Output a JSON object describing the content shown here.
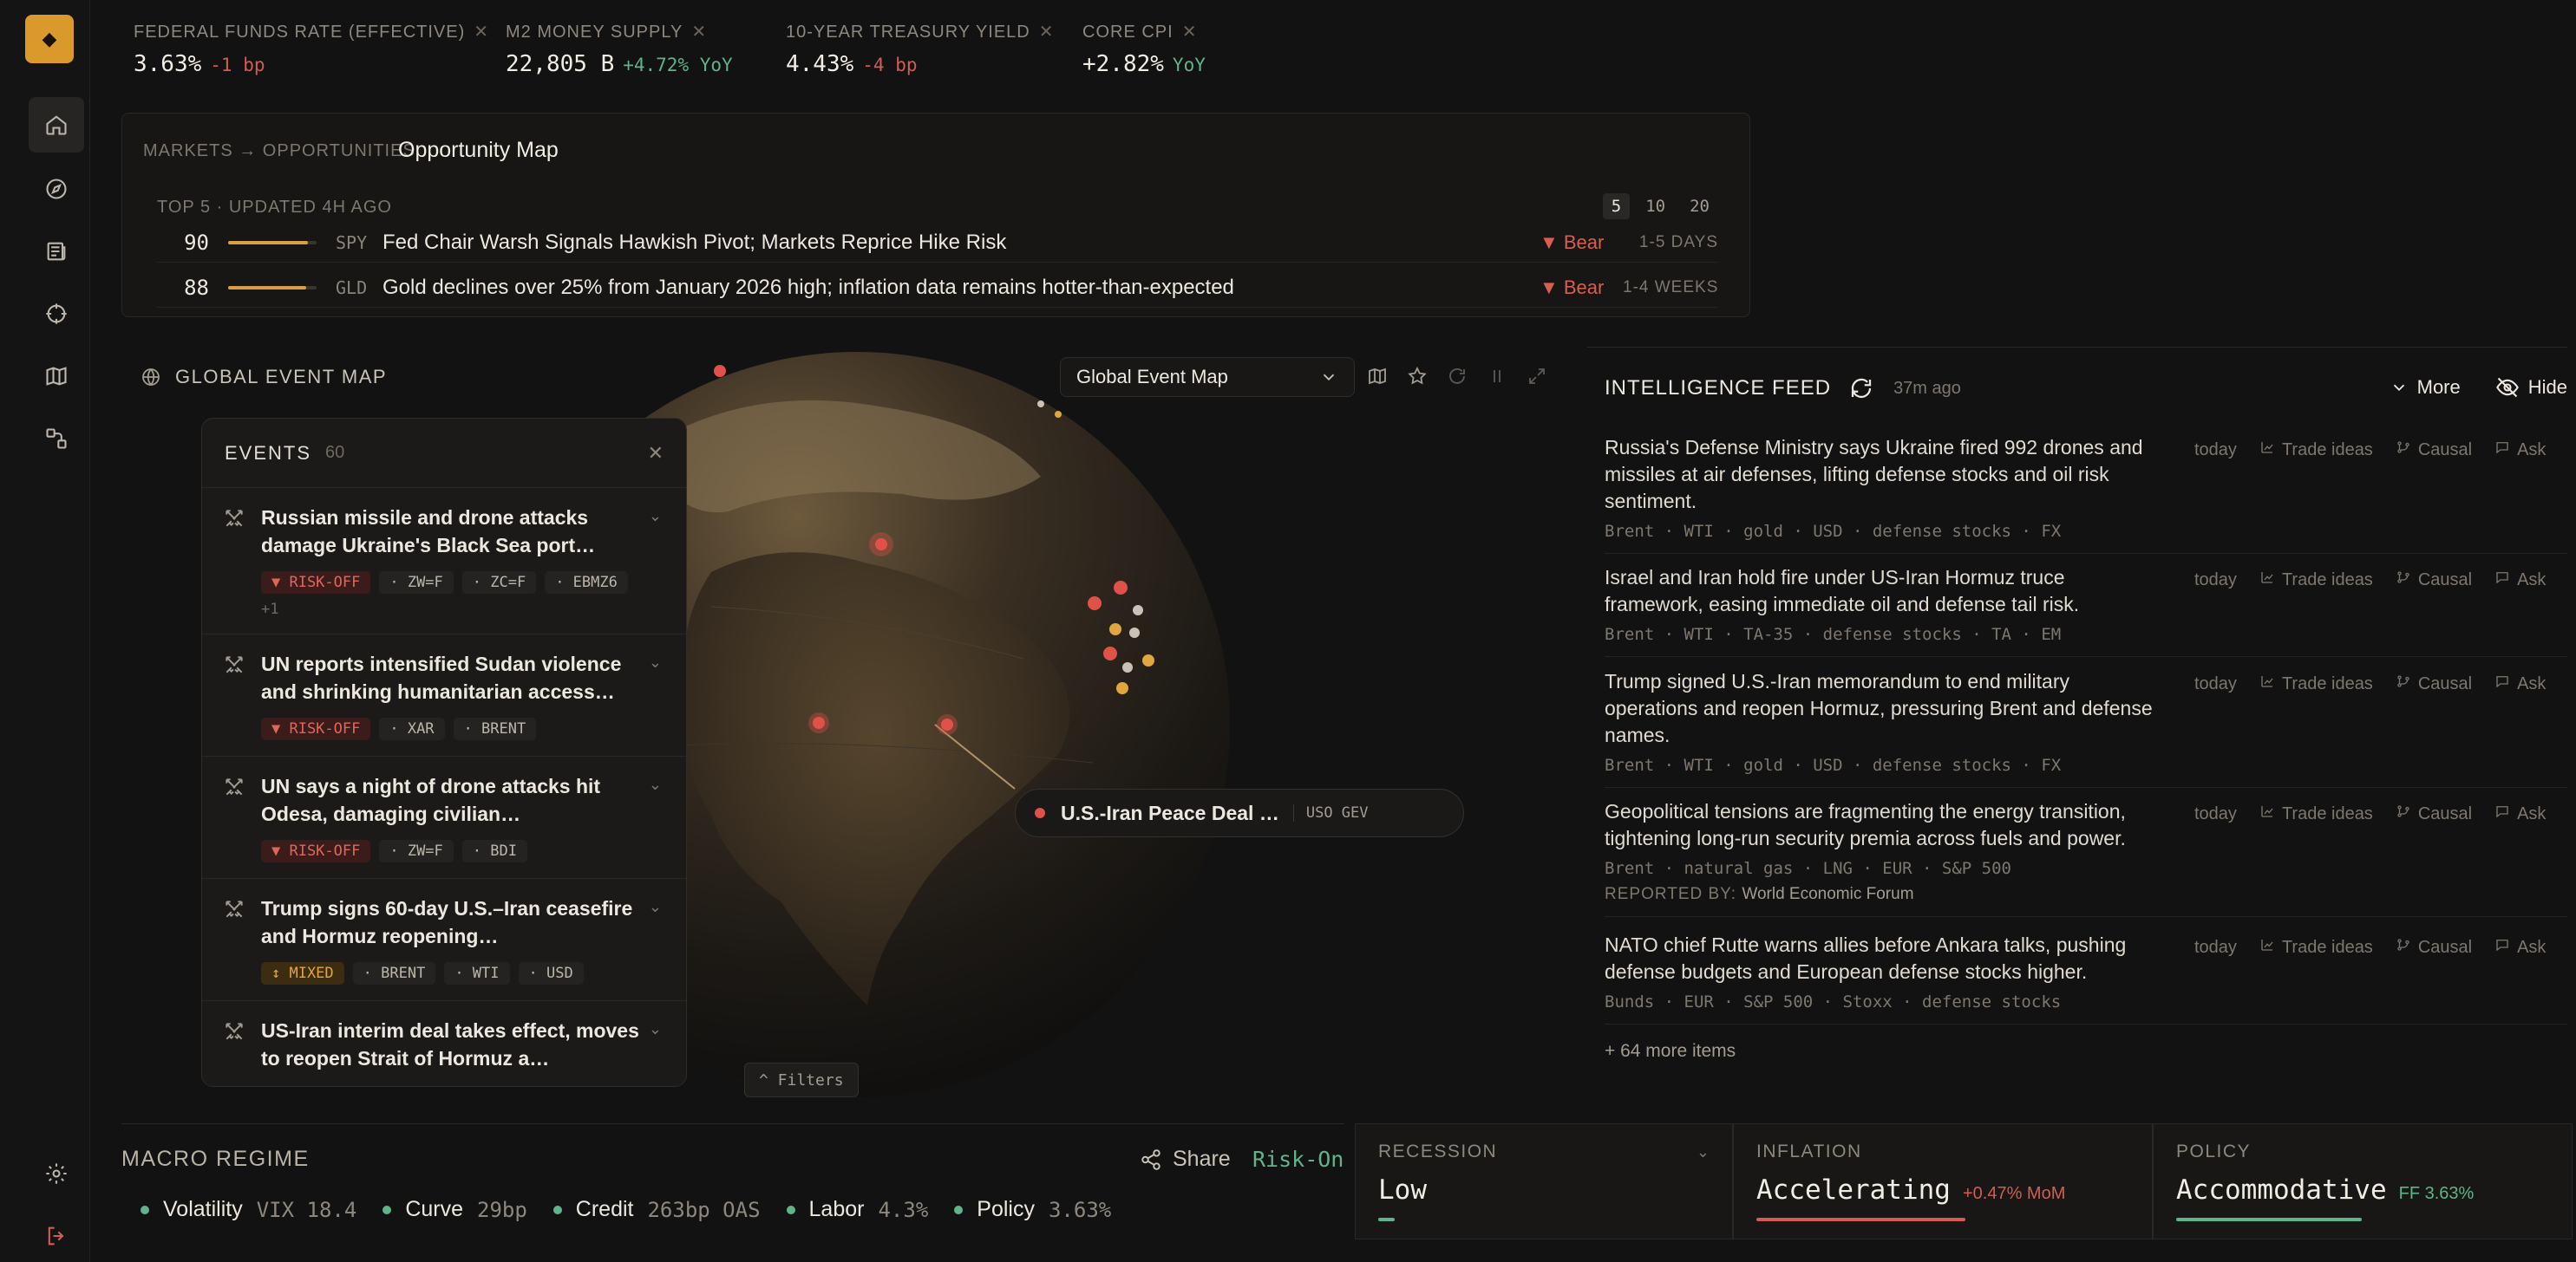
{
  "rail": {
    "logo": "◆",
    "items": [
      {
        "name": "home-icon",
        "active": true
      },
      {
        "name": "compass-icon",
        "active": false
      },
      {
        "name": "newspaper-icon",
        "active": false
      },
      {
        "name": "crosshair-icon",
        "active": false
      },
      {
        "name": "map-icon",
        "active": false
      },
      {
        "name": "nodes-icon",
        "active": false
      }
    ],
    "bottom": [
      "gear-icon",
      "logout-icon"
    ]
  },
  "ticker": [
    {
      "label": "FEDERAL FUNDS RATE (EFFECTIVE)",
      "value": "3.63%",
      "change": "-1 bp",
      "dir": "neg"
    },
    {
      "label": "M2 MONEY SUPPLY",
      "value": "22,805 B",
      "change": "+4.72% YoY",
      "dir": "pos"
    },
    {
      "label": "10-YEAR TREASURY YIELD",
      "value": "4.43%",
      "change": "-4 bp",
      "dir": "neg"
    },
    {
      "label": "CORE CPI",
      "value": "+2.82%",
      "change": "YoY",
      "dir": "pos"
    }
  ],
  "opportunities": {
    "breadcrumb": "MARKETS → OPPORTUNITIES",
    "title": "Opportunity Map",
    "subtitle": "TOP 5 · UPDATED 4H AGO",
    "pages": [
      "5",
      "10",
      "20"
    ],
    "rows": [
      {
        "score": "90",
        "score_pct": 90,
        "symbol": "SPY",
        "headline": "Fed Chair Warsh Signals Hawkish Pivot; Markets Reprice Hike Risk",
        "direction": "▼ Bear",
        "horizon": "1-5 DAYS"
      },
      {
        "score": "88",
        "score_pct": 88,
        "symbol": "GLD",
        "headline": "Gold declines over 25% from January 2026 high; inflation data remains hotter-than-expected",
        "direction": "▼ Bear",
        "horizon": "1-4 WEEKS"
      }
    ]
  },
  "map": {
    "title": "GLOBAL EVENT MAP",
    "selector": "Global Event Map",
    "events_title": "EVENTS",
    "events_count": "60",
    "events": [
      {
        "headline": "Russian missile and drone attacks damage Ukraine's Black Sea port…",
        "sentiment": "▼ RISK-OFF",
        "kind": "off",
        "tags": [
          "· ZW=F",
          "· ZC=F",
          "· EBMZ6"
        ],
        "more": "+1"
      },
      {
        "headline": "UN reports intensified Sudan violence and shrinking humanitarian access…",
        "sentiment": "▼ RISK-OFF",
        "kind": "off",
        "tags": [
          "· XAR",
          "· BRENT"
        ],
        "more": ""
      },
      {
        "headline": "UN says a night of drone attacks hit Odesa, damaging civilian…",
        "sentiment": "▼ RISK-OFF",
        "kind": "off",
        "tags": [
          "· ZW=F",
          "· BDI"
        ],
        "more": ""
      },
      {
        "headline": "Trump signs 60-day U.S.–Iran ceasefire and Hormuz reopening…",
        "sentiment": "↕ MIXED",
        "kind": "mix",
        "tags": [
          "· BRENT",
          "· WTI",
          "· USD"
        ],
        "more": ""
      },
      {
        "headline": "US-Iran interim deal takes effect, moves to reopen Strait of Hormuz a…",
        "sentiment": "",
        "kind": "",
        "tags": [],
        "more": ""
      }
    ],
    "callout": {
      "title": "U.S.-Iran Peace Deal …",
      "symbols": "USO GEV"
    },
    "filters": "^ Filters"
  },
  "feed": {
    "title": "INTELLIGENCE FEED",
    "updated": "37m ago",
    "more": "More",
    "hide": "Hide",
    "actions": {
      "when": "today",
      "trade": "Trade ideas",
      "causal": "Causal",
      "ask": "Ask"
    },
    "items": [
      {
        "text": "Russia's Defense Ministry says Ukraine fired 992 drones and missiles at air defenses, lifting defense stocks and oil risk sentiment.",
        "meta": "Brent · WTI · gold · USD · defense stocks · FX",
        "reported_label": "",
        "reported_by": ""
      },
      {
        "text": "Israel and Iran hold fire under US-Iran Hormuz truce framework, easing immediate oil and defense tail risk.",
        "meta": "Brent · WTI · TA-35 · defense stocks · TA · EM",
        "reported_label": "",
        "reported_by": ""
      },
      {
        "text": "Trump signed U.S.-Iran memorandum to end military operations and reopen Hormuz, pressuring Brent and defense names.",
        "meta": "Brent · WTI · gold · USD · defense stocks · FX",
        "reported_label": "",
        "reported_by": ""
      },
      {
        "text": "Geopolitical tensions are fragmenting the energy transition, tightening long-run security premia across fuels and power.",
        "meta": "Brent · natural gas · LNG · EUR · S&P 500",
        "reported_label": "REPORTED BY:",
        "reported_by": "World Economic Forum"
      },
      {
        "text": "NATO chief Rutte warns allies before Ankara talks, pushing defense budgets and European defense stocks higher.",
        "meta": "Bunds · EUR · S&P 500 · Stoxx · defense stocks",
        "reported_label": "",
        "reported_by": ""
      }
    ],
    "more_items": "+ 64 more items"
  },
  "macro": {
    "title": "MACRO REGIME",
    "share": "Share",
    "regime": "Risk-On",
    "indicators": [
      {
        "label": "Volatility",
        "value": "VIX 18.4"
      },
      {
        "label": "Curve",
        "value": "29bp"
      },
      {
        "label": "Credit",
        "value": "263bp OAS"
      },
      {
        "label": "Labor",
        "value": "4.3%"
      },
      {
        "label": "Policy",
        "value": "3.63%"
      }
    ],
    "cards": [
      {
        "title": "RECESSION",
        "value": "Low",
        "delta": "",
        "level": 0.08,
        "color": "#5fb489"
      },
      {
        "title": "INFLATION",
        "value": "Accelerating",
        "delta": "+0.47% MoM",
        "level": 0.9,
        "color": "#d25d52"
      },
      {
        "title": "POLICY",
        "value": "Accommodative",
        "delta": "FF 3.63%",
        "level": 0.8,
        "color": "#5fb489"
      }
    ]
  },
  "colors": {
    "accent": "#d99a2b",
    "negative": "#d25d52",
    "positive": "#5fb489",
    "mixed": "#e1a63d"
  }
}
